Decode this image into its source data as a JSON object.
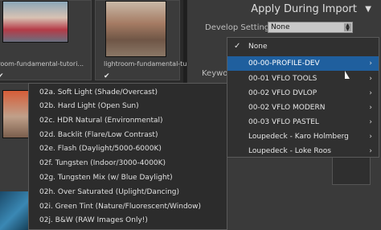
{
  "grid": {
    "items": [
      {
        "filename": "ntroom-fundamental-tutori..."
      },
      {
        "filename": "lightroom-fundamental-tutori..."
      }
    ],
    "check_glyph": "✔"
  },
  "panel": {
    "title": "Apply During Import",
    "collapse_icon": "triangle-down-icon",
    "develop_label": "Develop Settings",
    "develop_value": "None",
    "keywords_label": "Keywo"
  },
  "menu": {
    "items": [
      {
        "label": "None",
        "checked": true,
        "submenu": false
      },
      {
        "label": "00-00-PROFILE-DEV",
        "submenu": true,
        "highlighted": true
      },
      {
        "label": "00-01 VFLO TOOLS",
        "submenu": true
      },
      {
        "label": "00-02 VFLO DVLOP",
        "submenu": true
      },
      {
        "label": "00-02 VFLO MODERN",
        "submenu": true
      },
      {
        "label": "00-03 VFLO PASTEL",
        "submenu": true
      },
      {
        "label": "Loupedeck - Karo Holmberg",
        "submenu": true
      },
      {
        "label": "Loupedeck - Loke Roos",
        "submenu": true
      }
    ],
    "check_glyph": "✓",
    "submenu_glyph": "›"
  },
  "submenu": {
    "items": [
      {
        "label": "02a. Soft Light (Shade/Overcast)"
      },
      {
        "label": "02b. Hard Light (Open Sun)"
      },
      {
        "label": "02c. HDR Natural (Environmental)"
      },
      {
        "label": "02d. Backlit (Flare/Low Contrast)"
      },
      {
        "label": "02e. Flash (Daylight/5000-6000K)"
      },
      {
        "label": "02f. Tungsten (Indoor/3000-4000K)"
      },
      {
        "label": "02g. Tungsten Mix (w/ Blue Daylight)"
      },
      {
        "label": "02h. Over Saturated (Uplight/Dancing)"
      },
      {
        "label": "02i. Green Tint (Nature/Fluorescent/Window)"
      },
      {
        "label": "02j. B&W (RAW Images Only!)"
      }
    ]
  }
}
